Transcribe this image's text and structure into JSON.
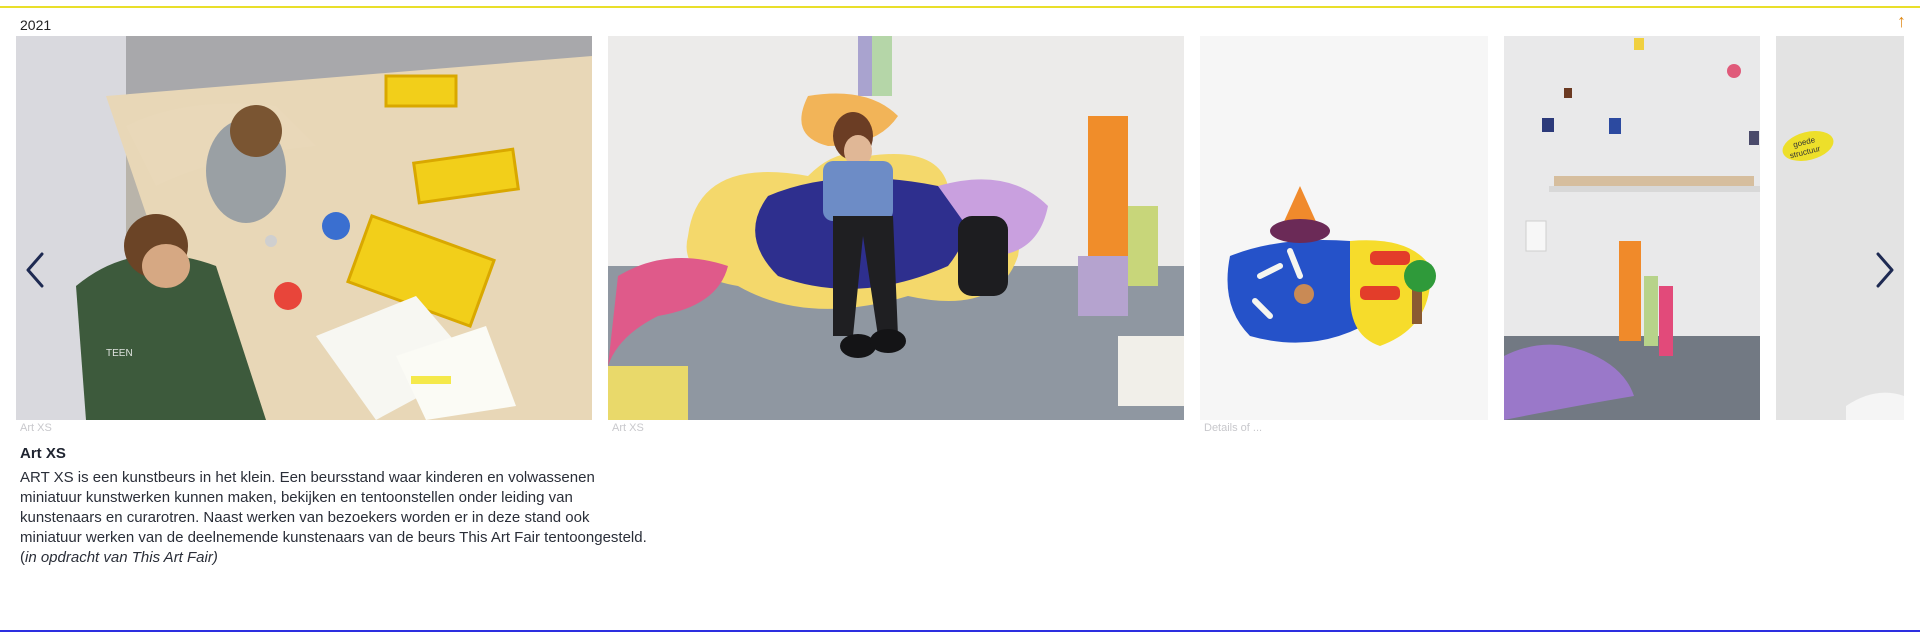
{
  "header": {
    "year": "2021",
    "back_to_top_icon": "arrow-up-icon",
    "accent_color": "#e9df2a"
  },
  "gallery": {
    "captions": [
      "Art XS",
      "Art XS",
      "Details of ..."
    ],
    "prev_icon": "chevron-left-icon",
    "next_icon": "chevron-right-icon",
    "images": [
      {
        "label": "Art XS",
        "depicts": "children-drawing-at-table"
      },
      {
        "label": "Art XS",
        "depicts": "woman-relaxing-on-pillows"
      },
      {
        "label": "Details of ...",
        "depicts": "clay-miniature-island"
      },
      {
        "label": "",
        "depicts": "wall-with-miniature-works"
      },
      {
        "label": "",
        "depicts": "wall-with-note"
      }
    ]
  },
  "project": {
    "title": "Art XS",
    "description_lines": [
      "ART XS is een kunstbeurs in het klein. Een beursstand waar kinderen en volwassenen",
      "miniatuur kunstwerken kunnen maken, bekijken en tentoonstellen onder leiding van",
      "kunstenaars en curarotren. Naast werken van bezoekers worden er in deze stand ook",
      "miniatuur werken van de deelnemende kunstenaars van de beurs This Art Fair tentoongesteld."
    ],
    "credit_open": "(",
    "credit": "in opdracht van This Art Fair)"
  },
  "footer": {
    "line_color": "#2d2fe0"
  }
}
